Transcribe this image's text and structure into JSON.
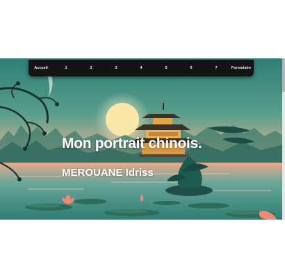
{
  "nav": {
    "items": [
      {
        "label": "Accueil"
      },
      {
        "label": "1"
      },
      {
        "label": "2"
      },
      {
        "label": "3"
      },
      {
        "label": "4"
      },
      {
        "label": "5"
      },
      {
        "label": "6"
      },
      {
        "label": "7"
      },
      {
        "label": "Formulaire"
      }
    ]
  },
  "hero": {
    "title": "Mon portrait chinois.",
    "subtitle": "MEROUANE Idriss"
  },
  "colors": {
    "nav_background": "#141414",
    "nav_text": "#f4f4f4",
    "sky_teal": "#3f8f84",
    "sunset_peach": "#f0b08a",
    "pagoda_gold": "#e0a040",
    "lotus_pink": "#f08878"
  }
}
